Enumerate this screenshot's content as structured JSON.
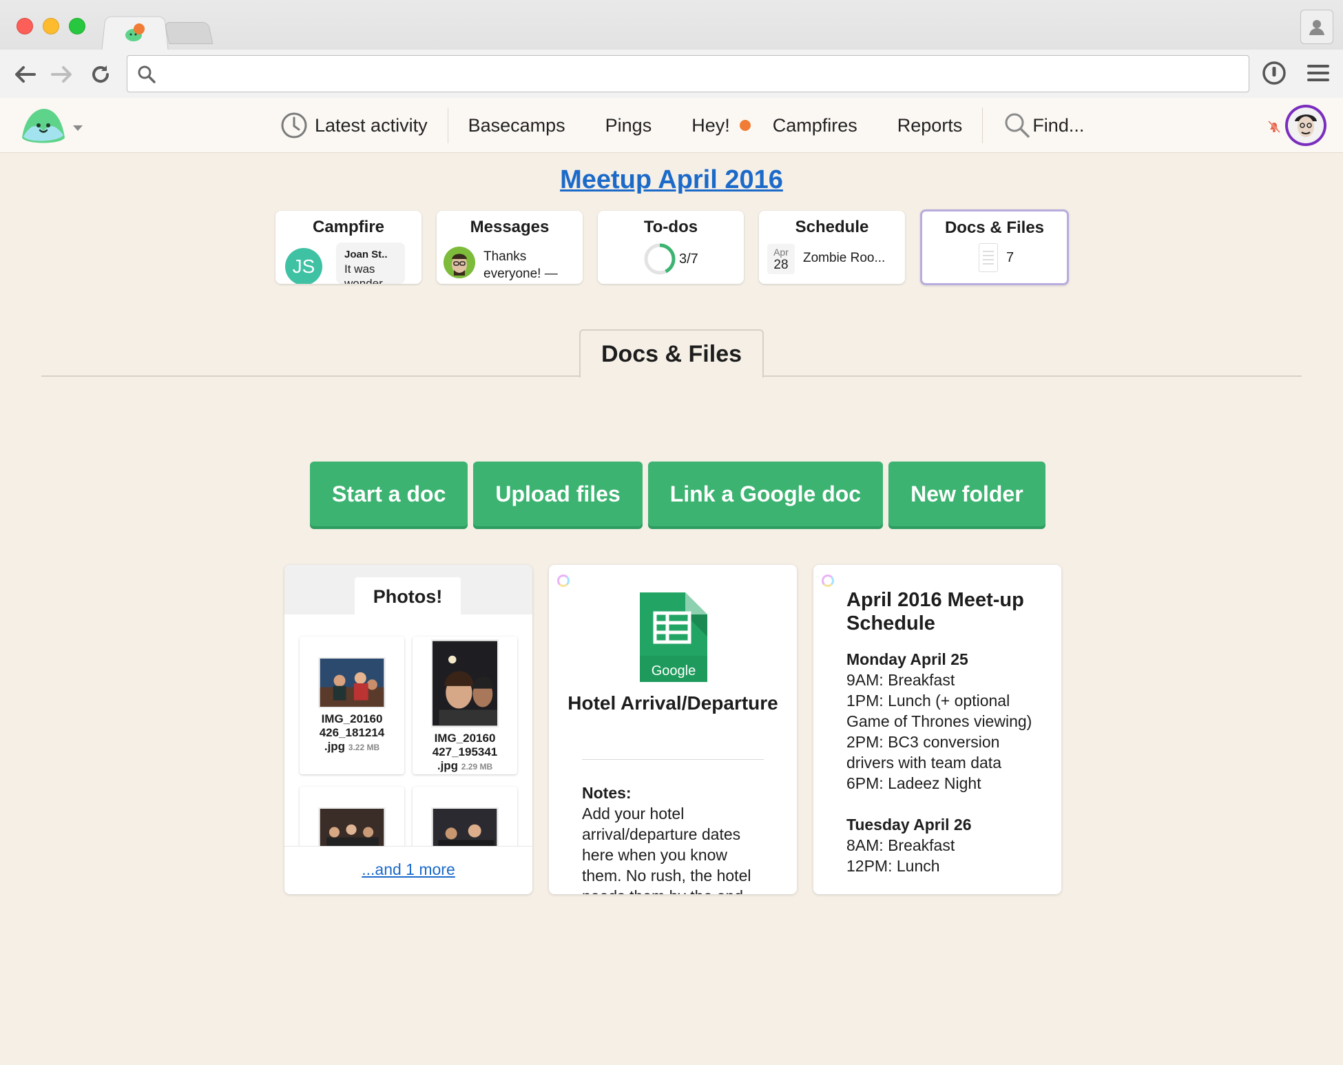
{
  "browser": {
    "url_value": "",
    "url_placeholder": ""
  },
  "appnav": {
    "items": [
      "Latest activity",
      "Basecamps",
      "Pings",
      "Hey!",
      "Campfires",
      "Reports",
      "Find..."
    ]
  },
  "project": {
    "title": "Meetup April 2016"
  },
  "tools": {
    "campfire": {
      "title": "Campfire",
      "avatar_initials": "JS",
      "author": "Joan St..",
      "text": "It was wonder..."
    },
    "messages": {
      "title": "Messages",
      "text": "Thanks everyone! —"
    },
    "todos": {
      "title": "To-dos",
      "progress_text": "3/7",
      "progress_fraction": 0.4286
    },
    "schedule": {
      "title": "Schedule",
      "month": "Apr",
      "day": "28",
      "event": "Zombie Roo..."
    },
    "docs": {
      "title": "Docs & Files",
      "count": "7"
    }
  },
  "section": {
    "title": "Docs & Files"
  },
  "actions": {
    "start_doc": "Start a doc",
    "upload_files": "Upload files",
    "link_google_doc": "Link a Google doc",
    "new_folder": "New folder"
  },
  "folder": {
    "title": "Photos!",
    "files": [
      {
        "name_lines": [
          "IMG_20160",
          "426_181214"
        ],
        "ext": ".jpg",
        "size": "3.22 MB"
      },
      {
        "name_lines": [
          "IMG_20160",
          "427_195341"
        ],
        "ext": ".jpg",
        "size": "2.29 MB"
      }
    ],
    "more_link": "...and 1 more"
  },
  "gdoc": {
    "brand": "Google",
    "title": "Hotel Arrival/Departure",
    "notes_label": "Notes:",
    "notes_text": "Add your hotel arrival/departure dates here when you know them. No rush, the hotel needs them by the end"
  },
  "schedule_doc": {
    "title": "April 2016 Meet-up Schedule",
    "day1": "Monday April 25",
    "day1_items": [
      "9AM: Breakfast",
      "1PM: Lunch (+ optional Game of Thrones viewing)",
      "2PM: BC3 conversion drivers with team data",
      "6PM: Ladeez Night"
    ],
    "day2": "Tuesday April 26",
    "day2_items": [
      "8AM: Breakfast",
      "12PM: Lunch"
    ]
  },
  "colors": {
    "background": "#f5efe6",
    "accent_green": "#3cb371",
    "link_blue": "#1b6ac9",
    "notification_orange": "#f07c35"
  }
}
